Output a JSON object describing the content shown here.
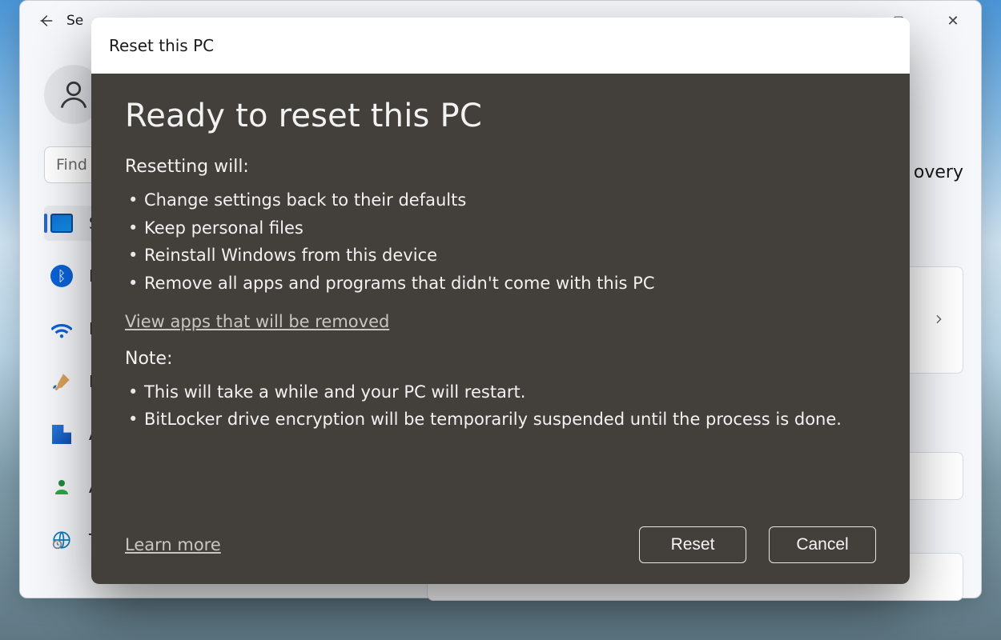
{
  "window": {
    "title_partial": "Se",
    "controls": {
      "minimize": "—",
      "maximize": "▢",
      "close": "✕"
    }
  },
  "page": {
    "right_label_partial": "overy"
  },
  "avatar": {
    "aria": "User avatar"
  },
  "search": {
    "placeholder": "Find a"
  },
  "sidebar": {
    "items": [
      {
        "label": "S",
        "icon": "system"
      },
      {
        "label": "B",
        "icon": "bluetooth"
      },
      {
        "label": "N",
        "icon": "wifi"
      },
      {
        "label": "P",
        "icon": "personalization"
      },
      {
        "label": "A",
        "icon": "apps"
      },
      {
        "label": "A",
        "icon": "accounts"
      },
      {
        "label": "T",
        "icon": "time-language"
      }
    ]
  },
  "dialog": {
    "header": "Reset this PC",
    "title": "Ready to reset this PC",
    "resetting_heading": "Resetting will:",
    "resetting_items": [
      "Change settings back to their defaults",
      "Keep personal files",
      "Reinstall Windows from this device",
      "Remove all apps and programs that didn't come with this PC"
    ],
    "view_apps_link": "View apps that will be removed",
    "note_heading": "Note:",
    "note_items": [
      "This will take a while and your PC will restart.",
      "BitLocker drive encryption will be temporarily suspended until the process is done."
    ],
    "learn_more": "Learn more",
    "reset_label": "Reset",
    "cancel_label": "Cancel"
  }
}
